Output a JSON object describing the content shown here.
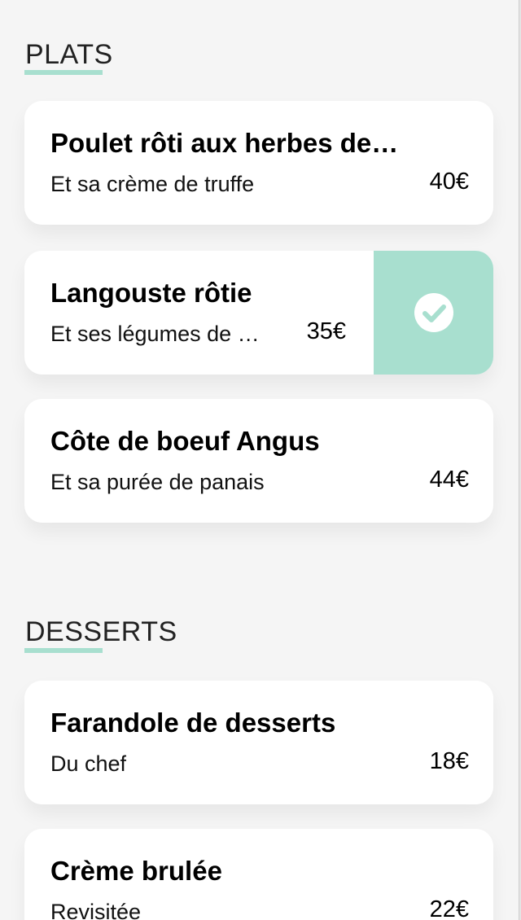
{
  "sections": [
    {
      "title": "PLATS",
      "items": [
        {
          "name": "Poulet rôti aux herbes de …",
          "description": "Et sa crème de truffe",
          "price": "40€"
        },
        {
          "name": "Langouste rôtie",
          "description": "Et ses légumes de …",
          "price": "35€",
          "swiped": true
        },
        {
          "name": "Côte de boeuf Angus",
          "description": "Et sa purée de panais",
          "price": "44€"
        }
      ]
    },
    {
      "title": "DESSERTS",
      "items": [
        {
          "name": "Farandole de desserts",
          "description": "Du chef",
          "price": "18€"
        },
        {
          "name": "Crème brulée",
          "description": "Revisitée",
          "price": "22€"
        }
      ]
    }
  ],
  "colors": {
    "accent": "#a8dfcf",
    "background": "#f5f5f5",
    "card": "#ffffff"
  },
  "icons": {
    "swipe_action": "check-circle-icon"
  }
}
